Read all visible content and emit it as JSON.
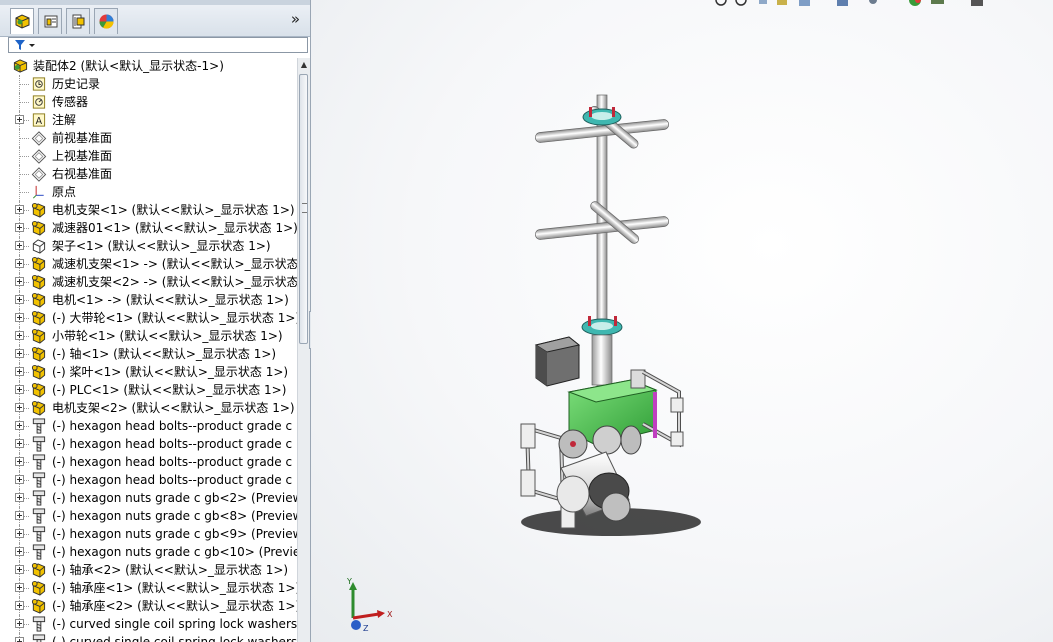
{
  "panel": {
    "tabs": [
      "feature-manager-icon",
      "property-manager-icon",
      "configuration-manager-icon",
      "display-manager-icon"
    ],
    "expand_arrow": "»"
  },
  "tree": {
    "items": [
      {
        "label": "装配体2 (默认<默认_显示状态-1>)",
        "icon": "assembly-icon",
        "expandable": false,
        "indent": 0
      },
      {
        "label": "历史记录",
        "icon": "history-icon",
        "expandable": false,
        "indent": 1
      },
      {
        "label": "传感器",
        "icon": "sensor-icon",
        "expandable": false,
        "indent": 1
      },
      {
        "label": "注解",
        "icon": "annotation-icon",
        "expandable": true,
        "indent": 1
      },
      {
        "label": "前视基准面",
        "icon": "plane-icon",
        "expandable": false,
        "indent": 1
      },
      {
        "label": "上视基准面",
        "icon": "plane-icon",
        "expandable": false,
        "indent": 1
      },
      {
        "label": "右视基准面",
        "icon": "plane-icon",
        "expandable": false,
        "indent": 1
      },
      {
        "label": "原点",
        "icon": "origin-icon",
        "expandable": false,
        "indent": 1
      },
      {
        "label": "电机支架<1> (默认<<默认>_显示状态 1>)",
        "icon": "part-icon",
        "expandable": true,
        "indent": 1
      },
      {
        "label": "减速器01<1> (默认<<默认>_显示状态 1>)",
        "icon": "part-icon",
        "expandable": true,
        "indent": 1
      },
      {
        "label": "架子<1> (默认<<默认>_显示状态 1>)",
        "icon": "part-outline-icon",
        "expandable": true,
        "indent": 1
      },
      {
        "label": "减速机支架<1> -> (默认<<默认>_显示状态",
        "icon": "part-icon",
        "expandable": true,
        "indent": 1
      },
      {
        "label": "减速机支架<2> -> (默认<<默认>_显示状态",
        "icon": "part-icon",
        "expandable": true,
        "indent": 1
      },
      {
        "label": "电机<1> -> (默认<<默认>_显示状态 1>)",
        "icon": "part-icon",
        "expandable": true,
        "indent": 1
      },
      {
        "label": "(-) 大带轮<1> (默认<<默认>_显示状态 1>)",
        "icon": "part-icon",
        "expandable": true,
        "indent": 1
      },
      {
        "label": "小带轮<1> (默认<<默认>_显示状态 1>)",
        "icon": "part-icon",
        "expandable": true,
        "indent": 1
      },
      {
        "label": "(-) 轴<1> (默认<<默认>_显示状态 1>)",
        "icon": "part-icon",
        "expandable": true,
        "indent": 1
      },
      {
        "label": "(-) 桨叶<1> (默认<<默认>_显示状态 1>)",
        "icon": "part-icon",
        "expandable": true,
        "indent": 1
      },
      {
        "label": "(-) PLC<1> (默认<<默认>_显示状态 1>)",
        "icon": "part-icon",
        "expandable": true,
        "indent": 1
      },
      {
        "label": "电机支架<2> (默认<<默认>_显示状态 1>)",
        "icon": "part-icon",
        "expandable": true,
        "indent": 1
      },
      {
        "label": "(-) hexagon head bolts--product grade c",
        "icon": "bolt-icon",
        "expandable": true,
        "indent": 1
      },
      {
        "label": "(-) hexagon head bolts--product grade c",
        "icon": "bolt-icon",
        "expandable": true,
        "indent": 1
      },
      {
        "label": "(-) hexagon head bolts--product grade c",
        "icon": "bolt-icon",
        "expandable": true,
        "indent": 1
      },
      {
        "label": "(-) hexagon head bolts--product grade c",
        "icon": "bolt-icon",
        "expandable": true,
        "indent": 1
      },
      {
        "label": "(-) hexagon nuts grade c gb<2> (Preview",
        "icon": "bolt-icon",
        "expandable": true,
        "indent": 1
      },
      {
        "label": "(-) hexagon nuts grade c gb<8> (Preview",
        "icon": "bolt-icon",
        "expandable": true,
        "indent": 1
      },
      {
        "label": "(-) hexagon nuts grade c gb<9> (Preview",
        "icon": "bolt-icon",
        "expandable": true,
        "indent": 1
      },
      {
        "label": "(-) hexagon nuts grade c gb<10> (Preview",
        "icon": "bolt-icon",
        "expandable": true,
        "indent": 1
      },
      {
        "label": "(-) 轴承<2> (默认<<默认>_显示状态 1>)",
        "icon": "part-icon",
        "expandable": true,
        "indent": 1
      },
      {
        "label": "(-) 轴承座<1> (默认<<默认>_显示状态 1>)",
        "icon": "part-icon",
        "expandable": true,
        "indent": 1
      },
      {
        "label": "(-) 轴承座<2> (默认<<默认>_显示状态 1>)",
        "icon": "part-icon",
        "expandable": true,
        "indent": 1
      },
      {
        "label": "(-) curved single coil spring lock washers",
        "icon": "bolt-icon",
        "expandable": true,
        "indent": 1
      },
      {
        "label": "(-) curved single coil spring lock washers",
        "icon": "bolt-icon",
        "expandable": true,
        "indent": 1
      }
    ]
  },
  "viewport": {
    "triad": {
      "x": "X",
      "y": "Y",
      "z": "Z"
    }
  },
  "colors": {
    "part_yellow": "#f2c200",
    "tree_line": "#9a9a9a",
    "model_green": "#47b94a",
    "model_teal": "#3fb7b0",
    "model_red": "#c0283a"
  }
}
